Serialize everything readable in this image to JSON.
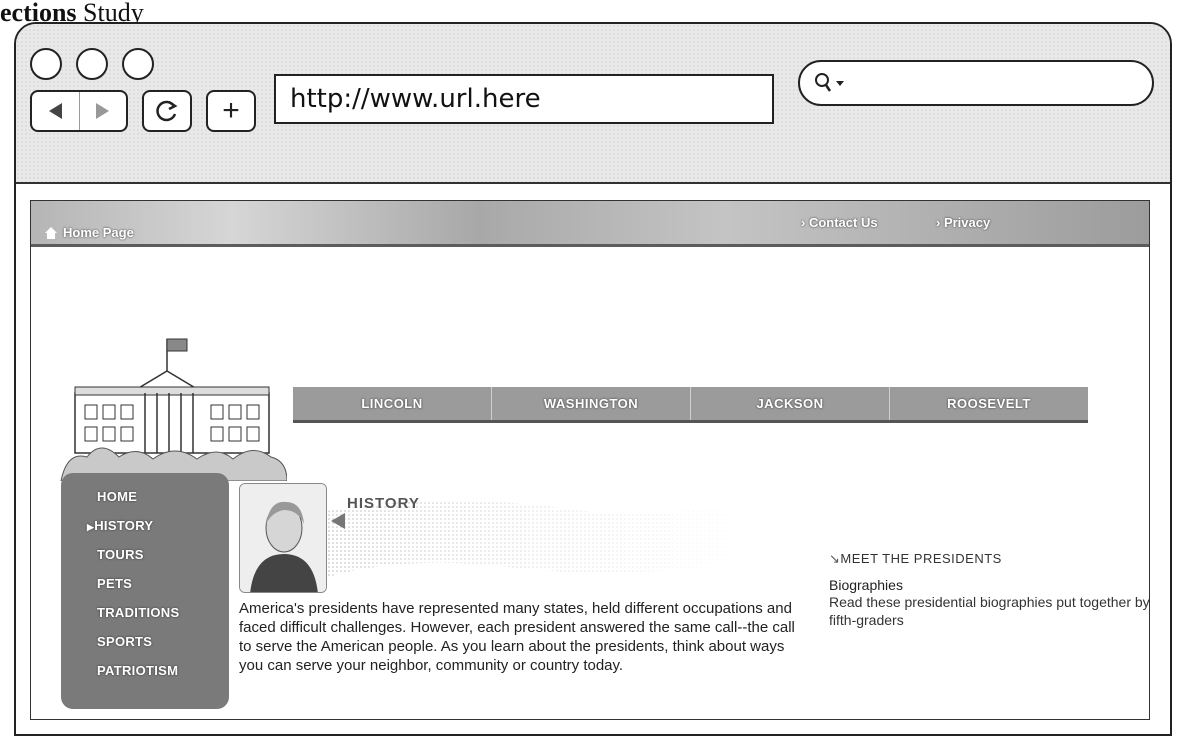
{
  "caption": {
    "prefix": "ections",
    "rest": " Study"
  },
  "browser": {
    "url": "http://www.url.here",
    "new_tab": "+",
    "search_placeholder": ""
  },
  "site": {
    "home_link": "Home Page",
    "top_links": [
      "› Contact Us",
      "› Privacy"
    ],
    "tabs": [
      "LINCOLN",
      "WASHINGTON",
      "JACKSON",
      "ROOSEVELT"
    ],
    "sidebar": [
      "HOME",
      "HISTORY",
      "TOURS",
      "PETS",
      "TRADITIONS",
      "SPORTS",
      "PATRIOTISM"
    ],
    "active_nav": "HISTORY",
    "history_title": "HISTORY",
    "intro": "America's presidents have represented many states, held different occupations and faced difficult challenges. However, each president answered the same call--the call to serve the American people. As you learn about the presidents, think about ways you can serve your neighbor, community or country today.",
    "meet": {
      "heading": "MEET THE PRESIDENTS",
      "title": "Biographies",
      "description": "Read these presidential biographies put together by fifth-graders"
    }
  }
}
